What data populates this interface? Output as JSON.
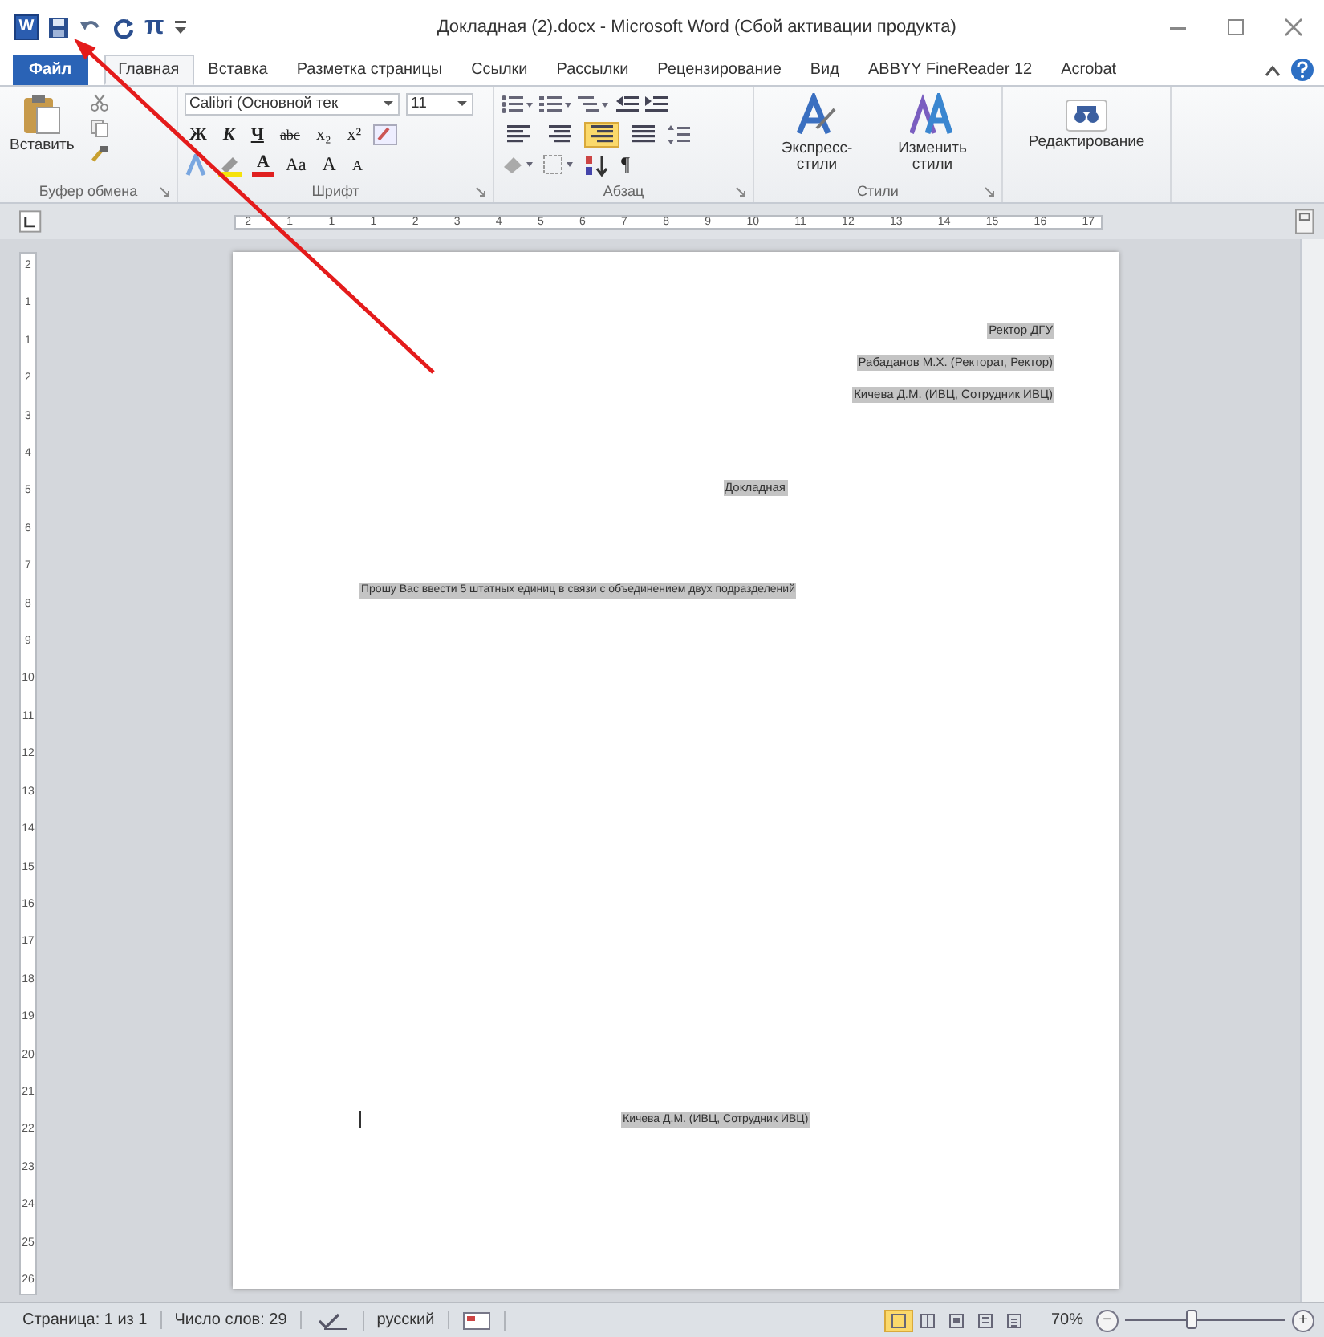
{
  "title_bar": {
    "app_icon": "W",
    "pi": "π",
    "title": "Докладная (2).docx - Microsoft Word (Сбой активации продукта)"
  },
  "tabs": [
    {
      "label": "Файл",
      "kind": "file",
      "selected": false
    },
    {
      "label": "Главная",
      "kind": "tab",
      "selected": true
    },
    {
      "label": "Вставка",
      "kind": "tab",
      "selected": false
    },
    {
      "label": "Разметка страницы",
      "kind": "tab",
      "selected": false
    },
    {
      "label": "Ссылки",
      "kind": "tab",
      "selected": false
    },
    {
      "label": "Рассылки",
      "kind": "tab",
      "selected": false
    },
    {
      "label": "Рецензирование",
      "kind": "tab",
      "selected": false
    },
    {
      "label": "Вид",
      "kind": "tab",
      "selected": false
    },
    {
      "label": "ABBYY FineReader 12",
      "kind": "tab",
      "selected": false
    },
    {
      "label": "Acrobat",
      "kind": "tab",
      "selected": false
    }
  ],
  "ribbon": {
    "paste": "Вставить",
    "font_name": "Calibri (Основной тек",
    "font_size": "11",
    "font_buttons": [
      "Ж",
      "К",
      "Ч",
      "abc",
      "x₂",
      "x²"
    ],
    "color_button": "A",
    "case_button": "Aa",
    "grow_button": "A",
    "shrink_button": "A",
    "align_buttons": [
      {
        "selected": false
      },
      {
        "selected": false
      },
      {
        "selected": true
      },
      {
        "selected": false
      }
    ],
    "pilcrow": "¶",
    "styles": [
      "Экспресс-стили",
      "Изменить стили"
    ],
    "editing": "Редактирование",
    "groups": [
      "Буфер обмена",
      "Шрифт",
      "Абзац",
      "Стили"
    ]
  },
  "hruler": [
    "2",
    "1",
    "1",
    "1",
    "2",
    "3",
    "4",
    "5",
    "6",
    "7",
    "8",
    "9",
    "10",
    "11",
    "12",
    "13",
    "14",
    "15",
    "16",
    "17"
  ],
  "vruler": [
    "2",
    "1",
    "1",
    "2",
    "3",
    "4",
    "5",
    "6",
    "7",
    "8",
    "9",
    "10",
    "11",
    "12",
    "13",
    "14",
    "15",
    "16",
    "17",
    "18",
    "19",
    "20",
    "21",
    "22",
    "23",
    "24",
    "25",
    "26"
  ],
  "document": {
    "right_lines": [
      "Ректор ДГУ",
      "Рабаданов М.Х. (Ректорат, Ректор)",
      "Кичева Д.М. (ИВЦ, Сотрудник ИВЦ)"
    ],
    "title": "Докладная",
    "body": "Прошу  Вас ввести 5 штатных единиц  в связи с объединением  двух подразделений",
    "signature": "Кичева Д.М. (ИВЦ, Сотрудник ИВЦ)"
  },
  "status_bar": {
    "page": "Страница: 1 из 1",
    "words": "Число слов: 29",
    "language": "русский",
    "views": [
      {
        "selected": true
      },
      {
        "selected": false
      },
      {
        "selected": false
      },
      {
        "selected": false
      },
      {
        "selected": false
      }
    ],
    "zoom": "70%",
    "zoom_out": "−",
    "zoom_in": "+",
    "level": 0.42
  }
}
